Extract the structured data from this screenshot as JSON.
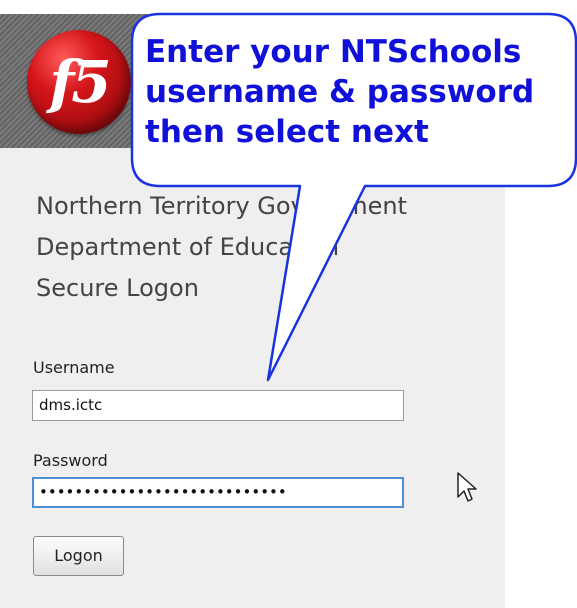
{
  "header": {
    "logo_text": "f5"
  },
  "org": {
    "line1": "Northern Territory Government",
    "line2": "Department of Education",
    "line3": "Secure Logon"
  },
  "form": {
    "username_label": "Username",
    "username_value": "dms.ictc",
    "password_label": "Password",
    "password_value": "••••••••••••••••••••••••••••",
    "logon_label": "Logon"
  },
  "callout": {
    "line1": "Enter your NTSchools",
    "line2": "username & password",
    "line3": "then select next",
    "text_color": "#1010d8",
    "border_color": "#1a33e0"
  },
  "icons": {
    "logo": "f5-logo-icon",
    "cursor": "mouse-cursor-icon"
  }
}
